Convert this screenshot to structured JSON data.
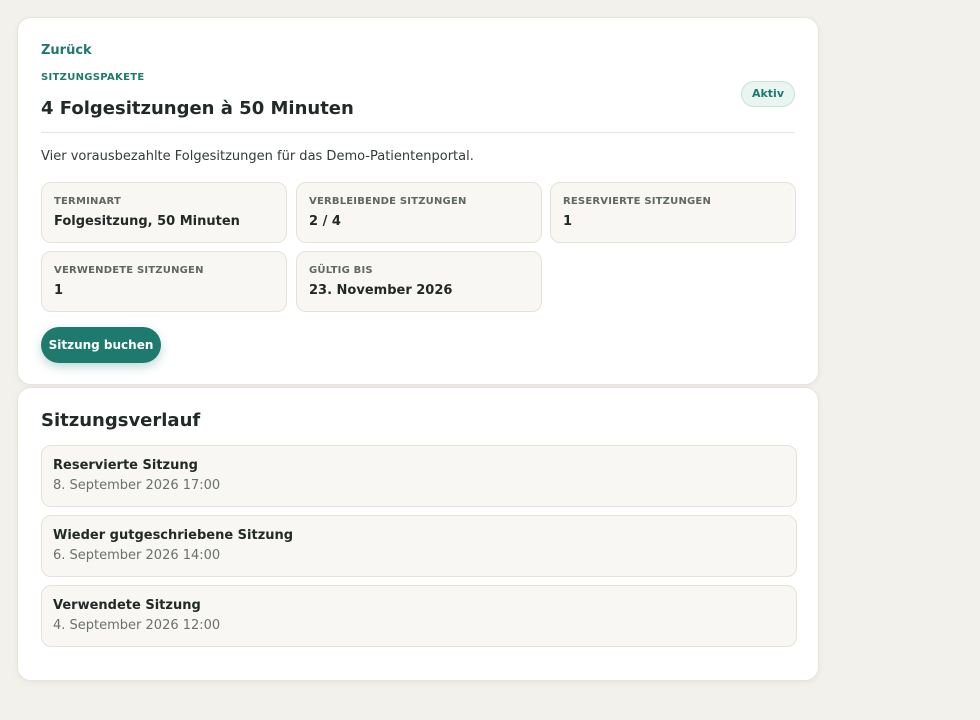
{
  "header": {
    "back_label": "Zurück",
    "eyebrow": "SITZUNGSPAKETE",
    "title": "4 Folgesitzungen à 50 Minuten",
    "status_badge": "Aktiv",
    "description": "Vier vorausbezahlte Folgesitzungen für das Demo-Patientenportal."
  },
  "details": [
    {
      "label": "TERMINART",
      "value": "Folgesitzung, 50 Minuten"
    },
    {
      "label": "VERBLEIBENDE SITZUNGEN",
      "value": "2 / 4"
    },
    {
      "label": "RESERVIERTE SITZUNGEN",
      "value": "1"
    },
    {
      "label": "VERWENDETE SITZUNGEN",
      "value": "1"
    },
    {
      "label": "GÜLTIG BIS",
      "value": "23. November 2026"
    }
  ],
  "actions": {
    "book_label": "Sitzung buchen"
  },
  "history": {
    "title": "Sitzungsverlauf",
    "items": [
      {
        "title": "Reservierte Sitzung",
        "date": "8. September 2026 17:00"
      },
      {
        "title": "Wieder gutgeschriebene Sitzung",
        "date": "6. September 2026 14:00"
      },
      {
        "title": "Verwendete Sitzung",
        "date": "4. September 2026 12:00"
      }
    ]
  },
  "colors": {
    "accent": "#1f7a6e",
    "background": "#f3f1ec",
    "card": "#ffffff",
    "tile": "#f8f7f3"
  }
}
